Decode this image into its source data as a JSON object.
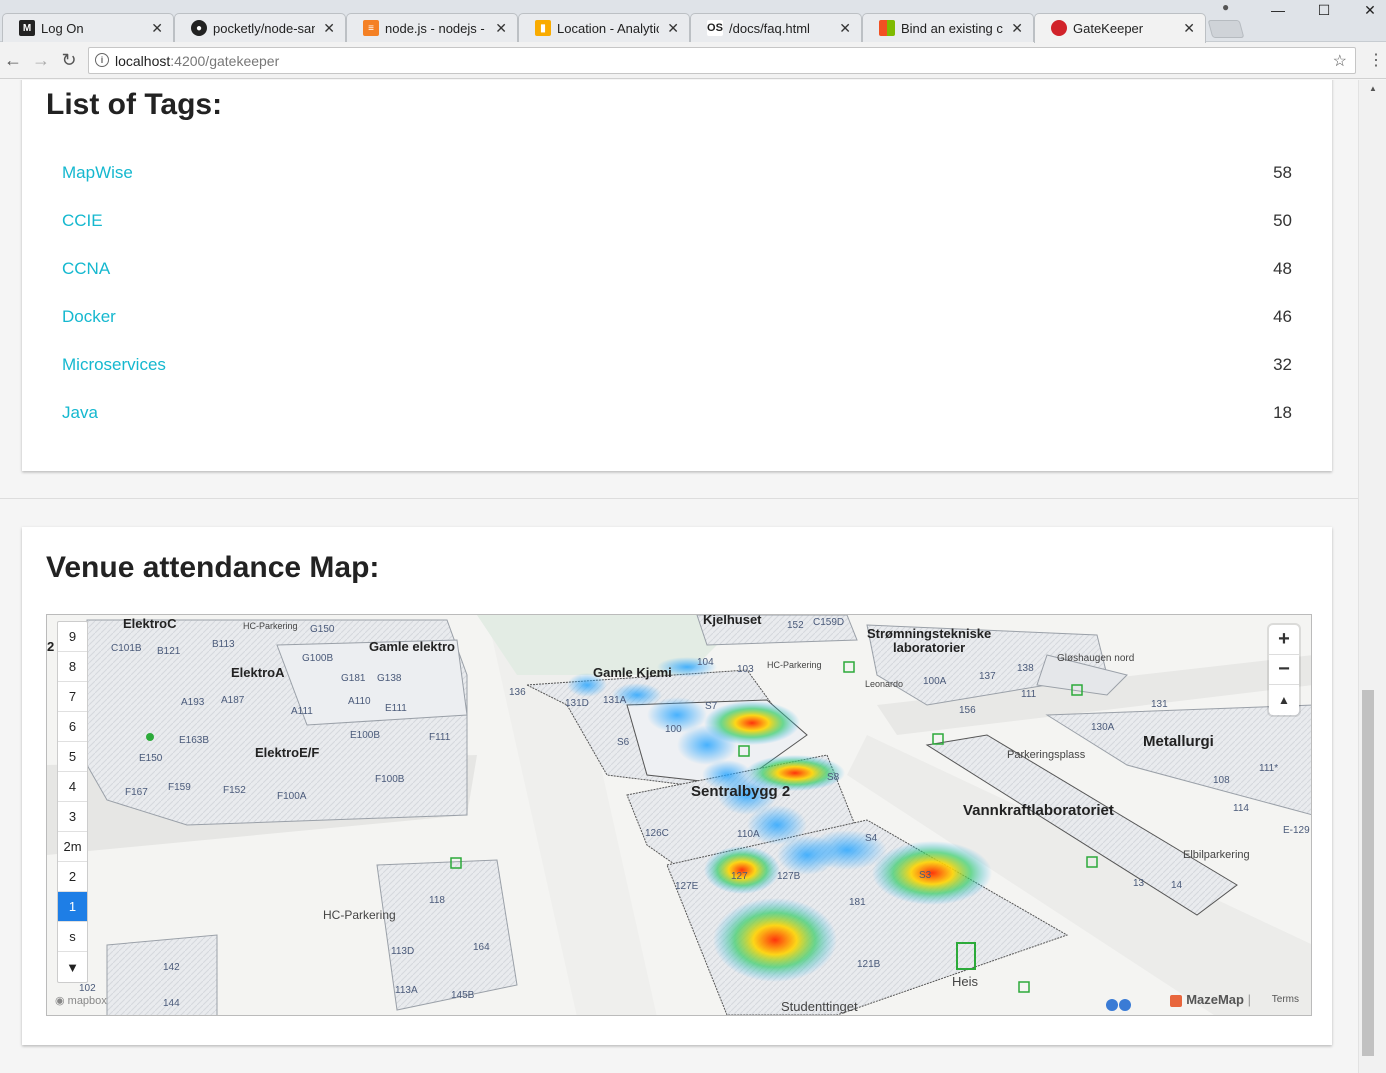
{
  "browser": {
    "tabs": [
      {
        "title": "Log On",
        "favicon": "M",
        "favicon_color": "#222222"
      },
      {
        "title": "pocketly/node-saniti",
        "favicon": "gh",
        "favicon_color": "#222222"
      },
      {
        "title": "node.js - nodejs - Ho",
        "favicon": "so",
        "favicon_color": "#f48024"
      },
      {
        "title": "Location - Analytics",
        "favicon": "ga",
        "favicon_color": "#f9ab00"
      },
      {
        "title": "/docs/faq.html",
        "favicon": "OS",
        "favicon_color": "#222222"
      },
      {
        "title": "Bind an existing cust",
        "favicon": "ms",
        "favicon_color": "#0078d7"
      },
      {
        "title": "GateKeeper",
        "favicon": "gk",
        "favicon_color": "#d1232a"
      }
    ],
    "url_host": "localhost",
    "url_path": ":4200/gatekeeper"
  },
  "tags_card": {
    "title": "List of Tags:",
    "items": [
      {
        "name": "MapWise",
        "count": "58"
      },
      {
        "name": "CCIE",
        "count": "50"
      },
      {
        "name": "CCNA",
        "count": "48"
      },
      {
        "name": "Docker",
        "count": "46"
      },
      {
        "name": "Microservices",
        "count": "32"
      },
      {
        "name": "Java",
        "count": "18"
      }
    ]
  },
  "map_card": {
    "title": "Venue attendance Map:",
    "floors": [
      "9",
      "8",
      "7",
      "6",
      "5",
      "4",
      "3",
      "2m",
      "2",
      "1",
      "s",
      "▼"
    ],
    "selected_floor": "1",
    "zoom_in": "+",
    "zoom_out": "−",
    "compass": "▲",
    "labels": {
      "elektroc": "ElektroC",
      "gamle_elektro": "Gamle elektro",
      "elektroa": "ElektroA",
      "elektroef": "ElektroE/F",
      "kjelhuset": "Kjelhuset",
      "gamle_kjemi": "Gamle Kjemi",
      "stromning": "Strømningstekniske\nlaboratorier",
      "gloshaugen": "Gløshaugen nord",
      "metallurgi": "Metallurgi",
      "parkeringsplass": "Parkeringsplass",
      "sentralbygg": "Sentralbygg 2",
      "vannkraft": "Vannkraftlaboratoriet",
      "elbil": "Elbilparkering",
      "hc1": "HC-Parkering",
      "hc2": "HC-Parkering",
      "hc3": "HC-Parkering",
      "heis": "Heis",
      "studenttinget": "Studenttinget",
      "leonardo": "Leonardo"
    },
    "rooms": [
      "C101B",
      "B121",
      "B113",
      "G150",
      "G100B",
      "G181",
      "G138",
      "A193",
      "A187",
      "A111",
      "A110",
      "E111",
      "E163B",
      "E100B",
      "F111",
      "E150",
      "F167",
      "F159",
      "F152",
      "F100A",
      "F100B",
      "104",
      "103",
      "152",
      "C159D",
      "136",
      "131D",
      "131A",
      "S7",
      "100",
      "S6",
      "S8",
      "126C",
      "110A",
      "S4",
      "127E",
      "127",
      "127B",
      "181",
      "S3",
      "121B",
      "118",
      "164",
      "113D",
      "113A",
      "145B",
      "142",
      "144",
      "102",
      "138",
      "137",
      "100A",
      "111",
      "156",
      "131",
      "130A",
      "111*",
      "108",
      "114",
      "E-129",
      "13",
      "14"
    ],
    "attribution_mapbox": "mapbox",
    "attribution_mazemap": "MazeMap",
    "attribution_terms": "Terms"
  }
}
